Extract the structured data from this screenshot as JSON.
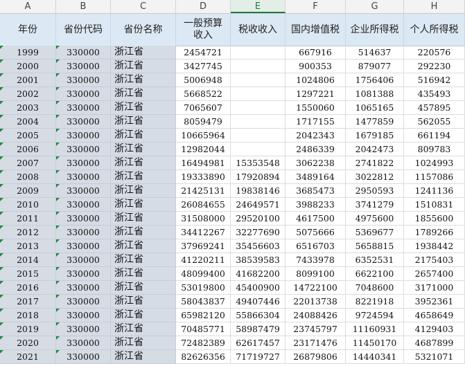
{
  "columns": [
    "A",
    "B",
    "C",
    "D",
    "E",
    "F",
    "G",
    "H"
  ],
  "active_column": "E",
  "headers": [
    "年份",
    "省份代码",
    "省份名称",
    "一般预算收入",
    "税收收入",
    "国内增值税",
    "企业所得税",
    "个人所得税"
  ],
  "rows": [
    [
      "1999",
      "330000",
      "浙江省",
      "2454721",
      "",
      "667916",
      "514637",
      "220576"
    ],
    [
      "2000",
      "330000",
      "浙江省",
      "3427745",
      "",
      "900353",
      "879077",
      "292230"
    ],
    [
      "2001",
      "330000",
      "浙江省",
      "5006948",
      "",
      "1024806",
      "1756406",
      "516942"
    ],
    [
      "2002",
      "330000",
      "浙江省",
      "5668522",
      "",
      "1297221",
      "1081388",
      "435493"
    ],
    [
      "2003",
      "330000",
      "浙江省",
      "7065607",
      "",
      "1550060",
      "1065165",
      "457895"
    ],
    [
      "2004",
      "330000",
      "浙江省",
      "8059479",
      "",
      "1717155",
      "1477859",
      "562055"
    ],
    [
      "2005",
      "330000",
      "浙江省",
      "10665964",
      "",
      "2042343",
      "1679185",
      "661194"
    ],
    [
      "2006",
      "330000",
      "浙江省",
      "12982044",
      "",
      "2486339",
      "2042473",
      "809783"
    ],
    [
      "2007",
      "330000",
      "浙江省",
      "16494981",
      "15353548",
      "3062238",
      "2741822",
      "1024993"
    ],
    [
      "2008",
      "330000",
      "浙江省",
      "19333890",
      "17920894",
      "3489164",
      "3022812",
      "1157086"
    ],
    [
      "2009",
      "330000",
      "浙江省",
      "21425131",
      "19838146",
      "3685473",
      "2950593",
      "1241136"
    ],
    [
      "2010",
      "330000",
      "浙江省",
      "26084655",
      "24649571",
      "3988233",
      "3741279",
      "1510831"
    ],
    [
      "2011",
      "330000",
      "浙江省",
      "31508000",
      "29520100",
      "4617500",
      "4975600",
      "1855600"
    ],
    [
      "2012",
      "330000",
      "浙江省",
      "34412267",
      "32277690",
      "5075666",
      "5369677",
      "1789266"
    ],
    [
      "2013",
      "330000",
      "浙江省",
      "37969241",
      "35456603",
      "6516703",
      "5658815",
      "1938442"
    ],
    [
      "2014",
      "330000",
      "浙江省",
      "41220211",
      "38539583",
      "7433978",
      "6352531",
      "2175403"
    ],
    [
      "2015",
      "330000",
      "浙江省",
      "48099400",
      "41682200",
      "8099100",
      "6622100",
      "2657400"
    ],
    [
      "2016",
      "330000",
      "浙江省",
      "53019800",
      "45400900",
      "14722100",
      "7048600",
      "3171000"
    ],
    [
      "2017",
      "330000",
      "浙江省",
      "58043837",
      "49407446",
      "22013738",
      "8221918",
      "3952361"
    ],
    [
      "2018",
      "330000",
      "浙江省",
      "65982120",
      "55866304",
      "24088426",
      "9724594",
      "4658649"
    ],
    [
      "2019",
      "330000",
      "浙江省",
      "70485771",
      "58987479",
      "23745797",
      "11160931",
      "4129403"
    ],
    [
      "2020",
      "330000",
      "浙江省",
      "72482389",
      "62617457",
      "23171476",
      "11450170",
      "4687899"
    ],
    [
      "2021",
      "330000",
      "浙江省",
      "82626356",
      "71719727",
      "26879806",
      "14440341",
      "5321071"
    ]
  ],
  "colors": {
    "header_fill": "#dce9f5",
    "grey_fill": "#d6dce4",
    "active_col": "#1e7b45",
    "marker": "#1d8a3a"
  }
}
